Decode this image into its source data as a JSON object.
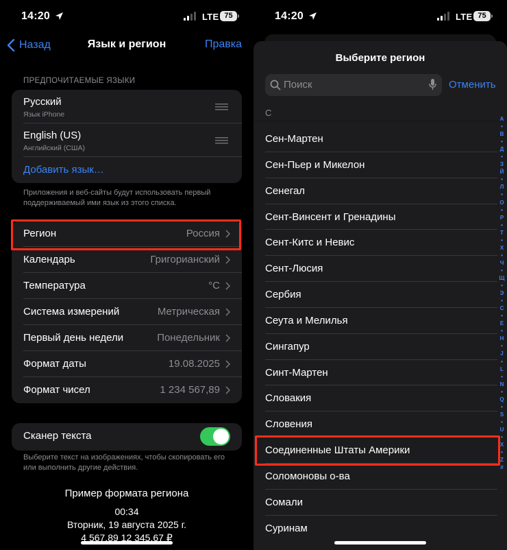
{
  "status": {
    "time": "14:20",
    "network": "LTE",
    "battery": "75"
  },
  "left": {
    "nav": {
      "back": "Назад",
      "title": "Язык и регион",
      "edit": "Правка"
    },
    "languages": {
      "header": "ПРЕДПОЧИТАЕМЫЕ ЯЗЫКИ",
      "items": [
        {
          "name": "Русский",
          "sub": "Язык iPhone"
        },
        {
          "name": "English (US)",
          "sub": "Английский (США)"
        }
      ],
      "add": "Добавить язык…",
      "footnote": "Приложения и веб-сайты будут использовать первый поддерживаемый ими язык из этого списка."
    },
    "settings": [
      {
        "label": "Регион",
        "value": "Россия"
      },
      {
        "label": "Календарь",
        "value": "Григорианский"
      },
      {
        "label": "Температура",
        "value": "°C"
      },
      {
        "label": "Система измерений",
        "value": "Метрическая"
      },
      {
        "label": "Первый день недели",
        "value": "Понедельник"
      },
      {
        "label": "Формат даты",
        "value": "19.08.2025"
      },
      {
        "label": "Формат чисел",
        "value": "1 234 567,89"
      }
    ],
    "scanner": {
      "label": "Сканер текста",
      "on": true,
      "footnote": "Выберите текст на изображениях, чтобы скопировать его или выполнить другие действия."
    },
    "example": {
      "title": "Пример формата региона",
      "lines": [
        "00:34",
        "Вторник, 19 августа 2025 г.",
        "4 567,89 12 345,67 ₽"
      ]
    }
  },
  "right": {
    "title": "Выберите регион",
    "search_placeholder": "Поиск",
    "cancel": "Отменить",
    "section_letter": "С",
    "regions": [
      "Сен-Мартен",
      "Сен-Пьер и Микелон",
      "Сенегал",
      "Сент-Винсент и Гренадины",
      "Сент-Китс и Невис",
      "Сент-Люсия",
      "Сербия",
      "Сеута и Мелилья",
      "Сингапур",
      "Синт-Мартен",
      "Словакия",
      "Словения",
      "Соединенные Штаты Америки",
      "Соломоновы о-ва",
      "Сомали",
      "Суринам"
    ],
    "index": [
      "А",
      "•",
      "В",
      "•",
      "Д",
      "•",
      "З",
      "Й",
      "•",
      "Л",
      "•",
      "О",
      "•",
      "Р",
      "•",
      "Т",
      "•",
      "Х",
      "•",
      "Ч",
      "•",
      "Щ",
      "•",
      "Э",
      "•",
      "С",
      "•",
      "E",
      "•",
      "H",
      "•",
      "J",
      "•",
      "L",
      "•",
      "N",
      "•",
      "Q",
      "•",
      "S",
      "•",
      "U",
      "•",
      "X",
      "•",
      "Z",
      "#"
    ]
  },
  "colors": {
    "accent": "#3b82f6",
    "highlight": "#ff2d1a",
    "toggle_on": "#34c759"
  }
}
